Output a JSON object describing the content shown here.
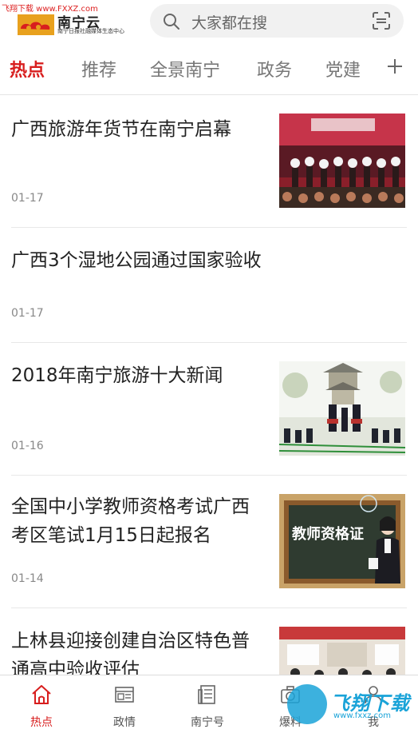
{
  "watermark_top": "飞翔下载 www.FXXZ.com",
  "header": {
    "logo_title": "南宁云",
    "logo_subtitle": "南宁日报社融媒体生态中心",
    "search_placeholder": "大家都在搜"
  },
  "tabs": [
    {
      "label": "热点",
      "active": true
    },
    {
      "label": "推荐",
      "active": false
    },
    {
      "label": "全景南宁",
      "active": false
    },
    {
      "label": "政务",
      "active": false
    },
    {
      "label": "党建",
      "active": false
    }
  ],
  "news": [
    {
      "title": "广西旅游年货节在南宁启幕",
      "date": "01-17",
      "thumb": "event-stage-photo"
    },
    {
      "title": "广西3个湿地公园通过国家验收",
      "date": "01-17",
      "thumb": null
    },
    {
      "title": "2018年南宁旅游十大新闻",
      "date": "01-16",
      "thumb": "folk-dance-photo"
    },
    {
      "title": "全国中小学教师资格考试广西考区笔试1月15日起报名",
      "date": "01-14",
      "thumb": "teacher-cert-photo",
      "thumb_text": "教师资格证"
    },
    {
      "title": "上林县迎接创建自治区特色普通高中验收评估",
      "date": "",
      "thumb": "classroom-photo"
    }
  ],
  "bottom_nav": [
    {
      "label": "热点",
      "icon": "home-icon",
      "active": true
    },
    {
      "label": "政情",
      "icon": "id-card-icon",
      "active": false
    },
    {
      "label": "南宁号",
      "icon": "document-icon",
      "active": false
    },
    {
      "label": "爆料",
      "icon": "camera-icon",
      "active": false
    },
    {
      "label": "我",
      "icon": "user-icon",
      "active": false
    }
  ],
  "watermark_bottom": {
    "text": "飞翔下载",
    "url": "www.fxxz.com"
  },
  "colors": {
    "accent": "#d81e1e",
    "watermark": "#1aa3d8"
  }
}
